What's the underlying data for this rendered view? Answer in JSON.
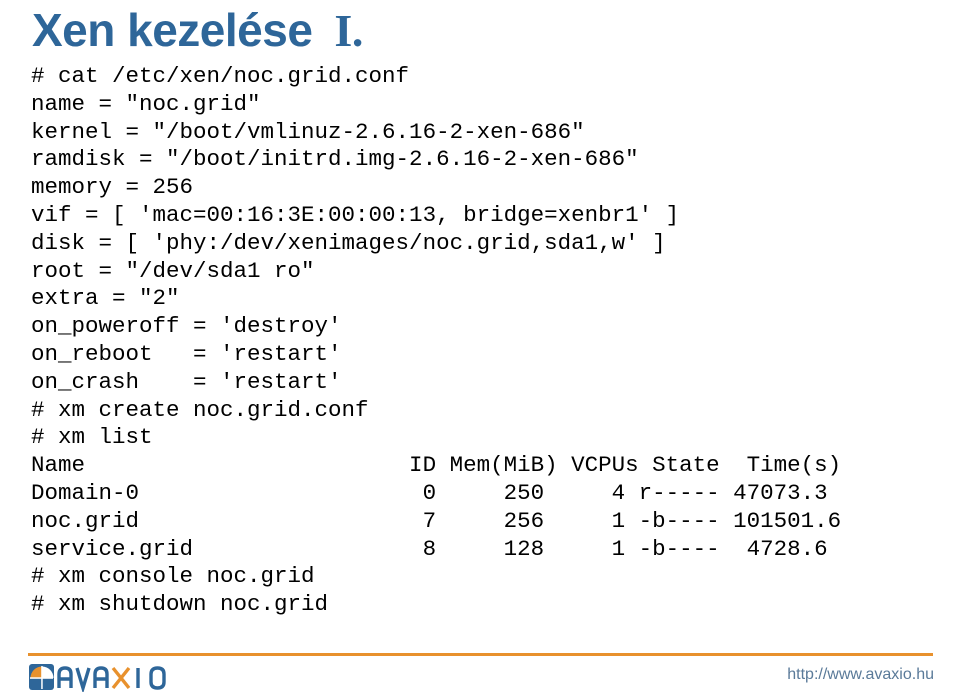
{
  "slide": {
    "title_main": "Xen kezelése",
    "title_roman": "I.",
    "title_color": "#2E6699"
  },
  "terminal": {
    "lines": [
      "# cat /etc/xen/noc.grid.conf",
      "name = \"noc.grid\"",
      "kernel = \"/boot/vmlinuz-2.6.16-2-xen-686\"",
      "ramdisk = \"/boot/initrd.img-2.6.16-2-xen-686\"",
      "memory = 256",
      "vif = [ 'mac=00:16:3E:00:00:13, bridge=xenbr1' ]",
      "disk = [ 'phy:/dev/xenimages/noc.grid,sda1,w' ]",
      "root = \"/dev/sda1 ro\"",
      "extra = \"2\"",
      "on_poweroff = 'destroy'",
      "on_reboot   = 'restart'",
      "on_crash    = 'restart'",
      "# xm create noc.grid.conf",
      "# xm list",
      "Name                        ID Mem(MiB) VCPUs State  Time(s)",
      "Domain-0                     0     250     4 r----- 47073.3",
      "noc.grid                     7     256     1 -b---- 101501.6",
      "service.grid                 8     128     1 -b----  4728.6",
      "# xm console noc.grid",
      "# xm shutdown noc.grid"
    ],
    "xm_list_table": {
      "columns": [
        "Name",
        "ID",
        "Mem(MiB)",
        "VCPUs",
        "State",
        "Time(s)"
      ],
      "rows": [
        [
          "Domain-0",
          "0",
          "250",
          "4",
          "r-----",
          "47073.3"
        ],
        [
          "noc.grid",
          "7",
          "256",
          "1",
          "-b----",
          "101501.6"
        ],
        [
          "service.grid",
          "8",
          "128",
          "1",
          "-b----",
          "4728.6"
        ]
      ]
    },
    "commands": [
      "cat /etc/xen/noc.grid.conf",
      "xm create noc.grid.conf",
      "xm list",
      "xm console noc.grid",
      "xm shutdown noc.grid"
    ]
  },
  "footer": {
    "logo_text": "AVAXIO",
    "url": "http://www.avaxio.hu",
    "rule_color": "#E8912D",
    "logo_blue": "#2E6699",
    "logo_orange": "#E8912D",
    "url_color": "#5A7A99"
  }
}
